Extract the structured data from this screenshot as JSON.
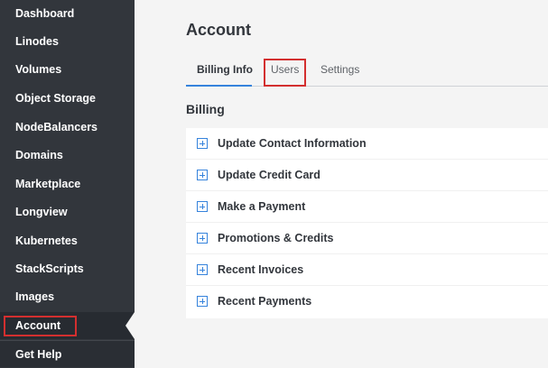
{
  "sidebar": {
    "items": [
      {
        "label": "Dashboard"
      },
      {
        "label": "Linodes"
      },
      {
        "label": "Volumes"
      },
      {
        "label": "Object Storage"
      },
      {
        "label": "NodeBalancers"
      },
      {
        "label": "Domains"
      },
      {
        "label": "Marketplace"
      },
      {
        "label": "Longview"
      },
      {
        "label": "Kubernetes"
      },
      {
        "label": "StackScripts"
      },
      {
        "label": "Images"
      },
      {
        "label": "Account"
      }
    ],
    "active_item": "Account",
    "help": {
      "label": "Get Help"
    }
  },
  "main": {
    "title": "Account",
    "tabs": [
      {
        "label": "Billing Info",
        "active": true
      },
      {
        "label": "Users",
        "active": false
      },
      {
        "label": "Settings",
        "active": false
      }
    ],
    "billing_section": {
      "title": "Billing",
      "panels": [
        {
          "label": "Update Contact Information"
        },
        {
          "label": "Update Credit Card"
        },
        {
          "label": "Make a Payment"
        },
        {
          "label": "Promotions & Credits"
        },
        {
          "label": "Recent Invoices"
        },
        {
          "label": "Recent Payments"
        }
      ]
    }
  },
  "colors": {
    "sidebar_bg": "#32363c",
    "accent": "#3683dc",
    "highlight": "#d32f2f",
    "page_bg": "#f4f4f4"
  },
  "icons": {
    "panel_expand": "plus-square-icon"
  }
}
